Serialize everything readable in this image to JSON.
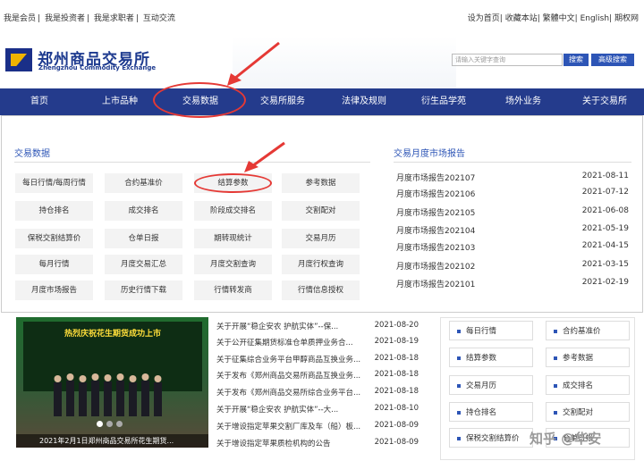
{
  "top_links": [
    "我是会员",
    "|",
    "我是投资者",
    "|",
    "我是求职者",
    "|",
    "互动交流"
  ],
  "right_links": [
    "设为首页",
    "|",
    "收藏本站",
    "|",
    "繁體中文",
    "|",
    "English",
    "|",
    "期权网"
  ],
  "logo": {
    "cn": "郑州商品交易所",
    "en": "Zhengzhou Commodity Exchange"
  },
  "search": {
    "placeholder": "请输入关键字查询",
    "search_btn": "搜索",
    "advanced_btn": "高级搜索"
  },
  "nav": [
    "首页",
    "上市品种",
    "交易数据",
    "交易所服务",
    "法律及规则",
    "衍生品学苑",
    "场外业务",
    "关于交易所"
  ],
  "dropdown": {
    "left_title": "交易数据",
    "right_title": "交易月度市场报告",
    "grid": [
      [
        "每日行情/每周行情",
        "合约基准价",
        "结算参数",
        "参考数据"
      ],
      [
        "持仓排名",
        "成交排名",
        "阶段成交排名",
        "交割配对"
      ],
      [
        "保税交割结算价",
        "仓单日报",
        "期转现统计",
        "交易月历"
      ],
      [
        "每月行情",
        "月度交易汇总",
        "月度交割查询",
        "月度行权查询"
      ],
      [
        "月度市场报告",
        "历史行情下载",
        "行情转发商",
        "行情信息授权"
      ]
    ],
    "reports": [
      {
        "title": "月度市场报告202107",
        "date": "2021-08-11"
      },
      {
        "title": "月度市场报告202106",
        "date": "2021-07-12"
      },
      {
        "title": "月度市场报告202105",
        "date": "2021-06-08"
      },
      {
        "title": "月度市场报告202104",
        "date": "2021-05-19"
      },
      {
        "title": "月度市场报告202103",
        "date": "2021-04-15"
      },
      {
        "title": "月度市场报告202102",
        "date": "2021-03-15"
      },
      {
        "title": "月度市场报告202101",
        "date": "2021-02-19"
      }
    ]
  },
  "banner": {
    "headline": "热烈庆祝花生期货成功上市",
    "caption": "2021年2月1日郑州商品交易所花生期货..."
  },
  "news": [
    {
      "title": "关于开展“稳企安农 护航实体”--保...",
      "date": "2021-08-20"
    },
    {
      "title": "关于公开征集期货标准仓单质押业务合...",
      "date": "2021-08-19"
    },
    {
      "title": "关于征集综合业务平台甲醇商品互换业务...",
      "date": "2021-08-18"
    },
    {
      "title": "关于发布《郑州商品交易所商品互换业务...",
      "date": "2021-08-18"
    },
    {
      "title": "关于发布《郑州商品交易所综合业务平台...",
      "date": "2021-08-18"
    },
    {
      "title": "关于开展“稳企安农 护航实体”--大...",
      "date": "2021-08-10"
    },
    {
      "title": "关于增设指定苹果交割厂库及车（船）板...",
      "date": "2021-08-09"
    },
    {
      "title": "关于增设指定苹果质检机构的公告",
      "date": "2021-08-09"
    }
  ],
  "quick_links": [
    "每日行情",
    "合约基准价",
    "结算参数",
    "参考数据",
    "交易月历",
    "成交排名",
    "持仓排名",
    "交割配对",
    "保税交割结算价",
    "仓单日报"
  ],
  "watermark": "知乎 @华安",
  "colors": {
    "nav_bg": "#243b8c",
    "accent": "#2d55b6",
    "annotation": "#e53935"
  }
}
